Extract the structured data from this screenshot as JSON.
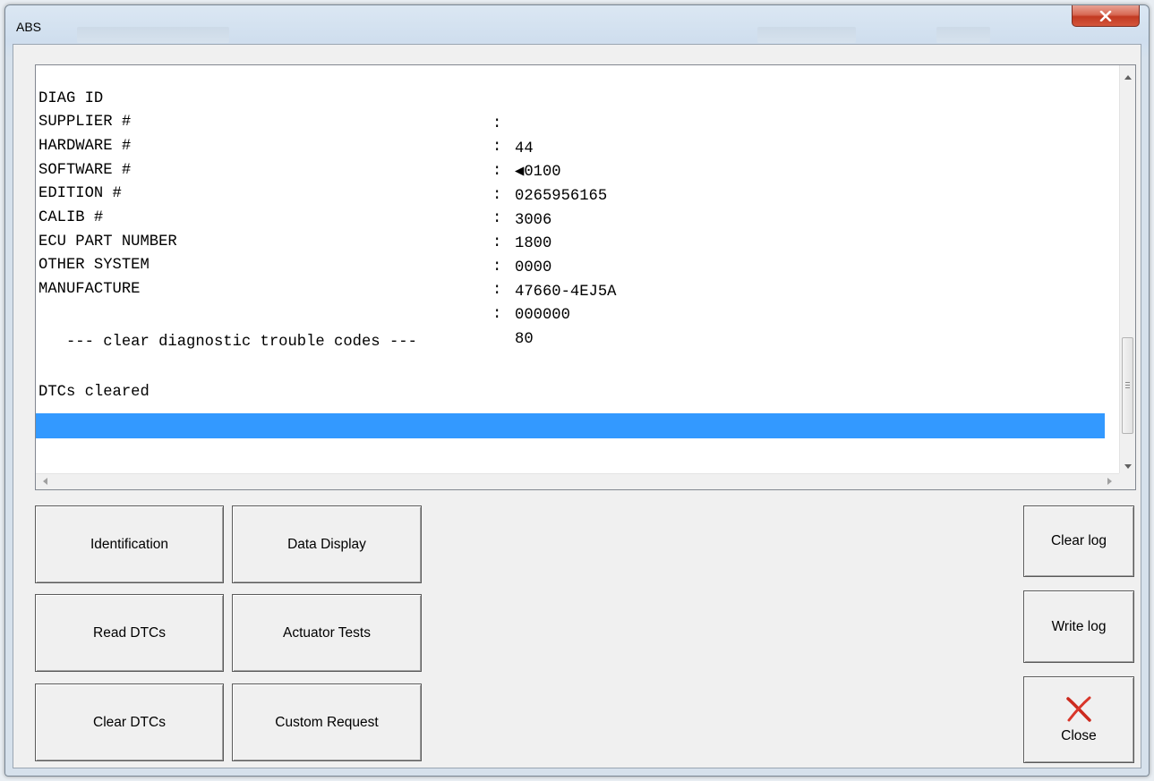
{
  "window": {
    "title": "ABS"
  },
  "log": {
    "rows": [
      {
        "key": "DIAG ID",
        "sep": ":",
        "value": "44"
      },
      {
        "key": "SUPPLIER #",
        "sep": ":",
        "value": "◀0100"
      },
      {
        "key": "HARDWARE #",
        "sep": ":",
        "value": "0265956165"
      },
      {
        "key": "SOFTWARE #",
        "sep": ":",
        "value": "3006"
      },
      {
        "key": "EDITION #",
        "sep": ":",
        "value": "1800"
      },
      {
        "key": "CALIB #",
        "sep": ":",
        "value": "0000"
      },
      {
        "key": "ECU PART NUMBER",
        "sep": ":",
        "value": "47660-4EJ5A"
      },
      {
        "key": "OTHER SYSTEM",
        "sep": ":",
        "value": "000000"
      },
      {
        "key": "MANUFACTURE",
        "sep": ":",
        "value": "80"
      }
    ],
    "section_header": "   --- clear diagnostic trouble codes ---",
    "status_line": "DTCs cleared"
  },
  "buttons": {
    "identification": "Identification",
    "data_display": "Data Display",
    "read_dtcs": "Read DTCs",
    "actuator_tests": "Actuator Tests",
    "clear_dtcs": "Clear DTCs",
    "custom_request": "Custom Request",
    "clear_log": "Clear log",
    "write_log": "Write log",
    "close": "Close"
  },
  "icons": {
    "window_close": "close-x-icon",
    "close_button": "red-x-icon"
  },
  "colors": {
    "selection": "#3399ff",
    "close_titlebar": "#c84a33",
    "close_icon": "#cc2a1e"
  }
}
